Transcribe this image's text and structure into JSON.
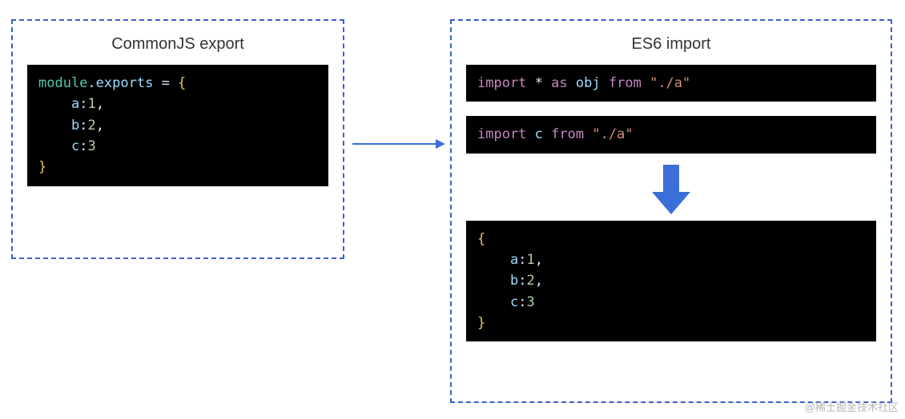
{
  "left": {
    "title": "CommonJS export",
    "code": {
      "module": "module",
      "dot": ".",
      "exports": "exports",
      "assign": " = ",
      "open": "{",
      "k1": "a",
      "c1": ":",
      "v1": "1",
      "comma1": ",",
      "k2": "b",
      "c2": ":",
      "v2": "2",
      "comma2": ",",
      "k3": "c",
      "c3": ":",
      "v3": "3",
      "close": "}"
    }
  },
  "right": {
    "title": "ES6 import",
    "code1": {
      "import": "import",
      "star": "*",
      "as": "as",
      "ident": "obj",
      "from": "from",
      "path": "\"./a\""
    },
    "code2": {
      "import": "import",
      "ident": "c",
      "from": "from",
      "path": "\"./a\""
    },
    "result": {
      "open": "{",
      "k1": "a",
      "c1": ":",
      "v1": "1",
      "comma1": ",",
      "k2": "b",
      "c2": ":",
      "v2": "2",
      "comma2": ",",
      "k3": "c",
      "c3": ":",
      "v3": "3",
      "close": "}"
    }
  },
  "watermark": "@稀土掘金技术社区"
}
